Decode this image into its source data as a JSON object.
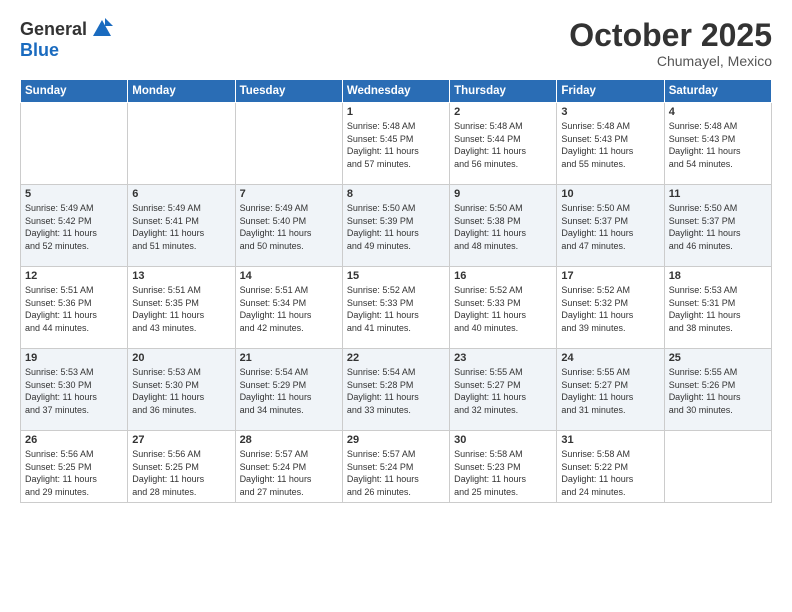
{
  "logo": {
    "general": "General",
    "blue": "Blue"
  },
  "header": {
    "month": "October 2025",
    "location": "Chumayel, Mexico"
  },
  "days_of_week": [
    "Sunday",
    "Monday",
    "Tuesday",
    "Wednesday",
    "Thursday",
    "Friday",
    "Saturday"
  ],
  "weeks": [
    [
      {
        "day": "",
        "info": ""
      },
      {
        "day": "",
        "info": ""
      },
      {
        "day": "",
        "info": ""
      },
      {
        "day": "1",
        "info": "Sunrise: 5:48 AM\nSunset: 5:45 PM\nDaylight: 11 hours\nand 57 minutes."
      },
      {
        "day": "2",
        "info": "Sunrise: 5:48 AM\nSunset: 5:44 PM\nDaylight: 11 hours\nand 56 minutes."
      },
      {
        "day": "3",
        "info": "Sunrise: 5:48 AM\nSunset: 5:43 PM\nDaylight: 11 hours\nand 55 minutes."
      },
      {
        "day": "4",
        "info": "Sunrise: 5:48 AM\nSunset: 5:43 PM\nDaylight: 11 hours\nand 54 minutes."
      }
    ],
    [
      {
        "day": "5",
        "info": "Sunrise: 5:49 AM\nSunset: 5:42 PM\nDaylight: 11 hours\nand 52 minutes."
      },
      {
        "day": "6",
        "info": "Sunrise: 5:49 AM\nSunset: 5:41 PM\nDaylight: 11 hours\nand 51 minutes."
      },
      {
        "day": "7",
        "info": "Sunrise: 5:49 AM\nSunset: 5:40 PM\nDaylight: 11 hours\nand 50 minutes."
      },
      {
        "day": "8",
        "info": "Sunrise: 5:50 AM\nSunset: 5:39 PM\nDaylight: 11 hours\nand 49 minutes."
      },
      {
        "day": "9",
        "info": "Sunrise: 5:50 AM\nSunset: 5:38 PM\nDaylight: 11 hours\nand 48 minutes."
      },
      {
        "day": "10",
        "info": "Sunrise: 5:50 AM\nSunset: 5:37 PM\nDaylight: 11 hours\nand 47 minutes."
      },
      {
        "day": "11",
        "info": "Sunrise: 5:50 AM\nSunset: 5:37 PM\nDaylight: 11 hours\nand 46 minutes."
      }
    ],
    [
      {
        "day": "12",
        "info": "Sunrise: 5:51 AM\nSunset: 5:36 PM\nDaylight: 11 hours\nand 44 minutes."
      },
      {
        "day": "13",
        "info": "Sunrise: 5:51 AM\nSunset: 5:35 PM\nDaylight: 11 hours\nand 43 minutes."
      },
      {
        "day": "14",
        "info": "Sunrise: 5:51 AM\nSunset: 5:34 PM\nDaylight: 11 hours\nand 42 minutes."
      },
      {
        "day": "15",
        "info": "Sunrise: 5:52 AM\nSunset: 5:33 PM\nDaylight: 11 hours\nand 41 minutes."
      },
      {
        "day": "16",
        "info": "Sunrise: 5:52 AM\nSunset: 5:33 PM\nDaylight: 11 hours\nand 40 minutes."
      },
      {
        "day": "17",
        "info": "Sunrise: 5:52 AM\nSunset: 5:32 PM\nDaylight: 11 hours\nand 39 minutes."
      },
      {
        "day": "18",
        "info": "Sunrise: 5:53 AM\nSunset: 5:31 PM\nDaylight: 11 hours\nand 38 minutes."
      }
    ],
    [
      {
        "day": "19",
        "info": "Sunrise: 5:53 AM\nSunset: 5:30 PM\nDaylight: 11 hours\nand 37 minutes."
      },
      {
        "day": "20",
        "info": "Sunrise: 5:53 AM\nSunset: 5:30 PM\nDaylight: 11 hours\nand 36 minutes."
      },
      {
        "day": "21",
        "info": "Sunrise: 5:54 AM\nSunset: 5:29 PM\nDaylight: 11 hours\nand 34 minutes."
      },
      {
        "day": "22",
        "info": "Sunrise: 5:54 AM\nSunset: 5:28 PM\nDaylight: 11 hours\nand 33 minutes."
      },
      {
        "day": "23",
        "info": "Sunrise: 5:55 AM\nSunset: 5:27 PM\nDaylight: 11 hours\nand 32 minutes."
      },
      {
        "day": "24",
        "info": "Sunrise: 5:55 AM\nSunset: 5:27 PM\nDaylight: 11 hours\nand 31 minutes."
      },
      {
        "day": "25",
        "info": "Sunrise: 5:55 AM\nSunset: 5:26 PM\nDaylight: 11 hours\nand 30 minutes."
      }
    ],
    [
      {
        "day": "26",
        "info": "Sunrise: 5:56 AM\nSunset: 5:25 PM\nDaylight: 11 hours\nand 29 minutes."
      },
      {
        "day": "27",
        "info": "Sunrise: 5:56 AM\nSunset: 5:25 PM\nDaylight: 11 hours\nand 28 minutes."
      },
      {
        "day": "28",
        "info": "Sunrise: 5:57 AM\nSunset: 5:24 PM\nDaylight: 11 hours\nand 27 minutes."
      },
      {
        "day": "29",
        "info": "Sunrise: 5:57 AM\nSunset: 5:24 PM\nDaylight: 11 hours\nand 26 minutes."
      },
      {
        "day": "30",
        "info": "Sunrise: 5:58 AM\nSunset: 5:23 PM\nDaylight: 11 hours\nand 25 minutes."
      },
      {
        "day": "31",
        "info": "Sunrise: 5:58 AM\nSunset: 5:22 PM\nDaylight: 11 hours\nand 24 minutes."
      },
      {
        "day": "",
        "info": ""
      }
    ]
  ]
}
